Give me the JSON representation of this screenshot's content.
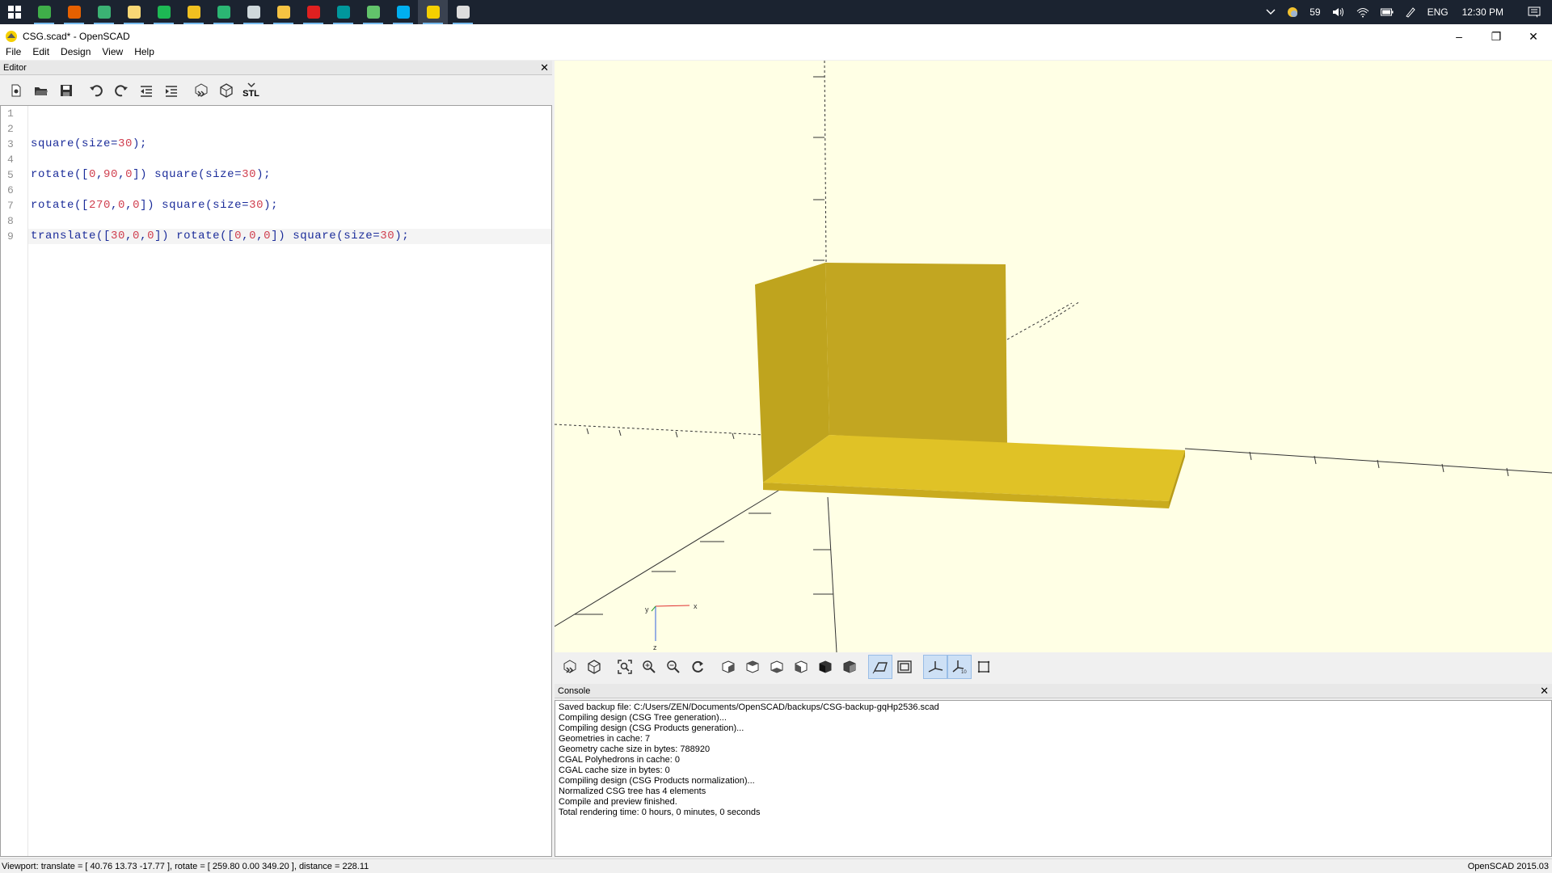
{
  "taskbar": {
    "apps": [
      {
        "name": "notepad-plus",
        "color": "#3fae49"
      },
      {
        "name": "firefox",
        "color": "#e66000"
      },
      {
        "name": "green-app",
        "color": "#3bb274"
      },
      {
        "name": "file-explorer",
        "color": "#f8d775"
      },
      {
        "name": "spotify",
        "color": "#1db954"
      },
      {
        "name": "git",
        "color": "#f0c020"
      },
      {
        "name": "green-arrow-app",
        "color": "#2bb673"
      },
      {
        "name": "terminal-app",
        "color": "#cfd8dc"
      },
      {
        "name": "sticky-notes",
        "color": "#f6c342"
      },
      {
        "name": "acrobat",
        "color": "#e02020"
      },
      {
        "name": "arduino",
        "color": "#00979c"
      },
      {
        "name": "green-circle-app",
        "color": "#62c36b"
      },
      {
        "name": "skype",
        "color": "#00aff0"
      },
      {
        "name": "openscad",
        "color": "#f5d000"
      },
      {
        "name": "chrome",
        "color": "#dddddd"
      }
    ],
    "tray": {
      "temperature": "59",
      "language": "ENG",
      "time": "12:30 PM"
    }
  },
  "window": {
    "title": "CSG.scad* - OpenSCAD",
    "controls": {
      "minimize": "–",
      "maximize": "❐",
      "close": "✕"
    }
  },
  "menu": [
    "File",
    "Edit",
    "Design",
    "View",
    "Help"
  ],
  "editor": {
    "dock_title": "Editor",
    "dock_close": "✕",
    "stl_label": "STL",
    "line_numbers": [
      "1",
      "2",
      "3",
      "4",
      "5",
      "6",
      "7",
      "8",
      "9"
    ],
    "lines": [
      [],
      [],
      [
        {
          "t": "square(size=",
          "k": "f"
        },
        {
          "t": "30",
          "k": "n"
        },
        {
          "t": ");",
          "k": "f"
        }
      ],
      [],
      [
        {
          "t": "rotate([",
          "k": "f"
        },
        {
          "t": "0",
          "k": "n"
        },
        {
          "t": ",",
          "k": "f"
        },
        {
          "t": "90",
          "k": "n"
        },
        {
          "t": ",",
          "k": "f"
        },
        {
          "t": "0",
          "k": "n"
        },
        {
          "t": "]) square(size=",
          "k": "f"
        },
        {
          "t": "30",
          "k": "n"
        },
        {
          "t": ");",
          "k": "f"
        }
      ],
      [],
      [
        {
          "t": "rotate([",
          "k": "f"
        },
        {
          "t": "270",
          "k": "n"
        },
        {
          "t": ",",
          "k": "f"
        },
        {
          "t": "0",
          "k": "n"
        },
        {
          "t": ",",
          "k": "f"
        },
        {
          "t": "0",
          "k": "n"
        },
        {
          "t": "]) square(size=",
          "k": "f"
        },
        {
          "t": "30",
          "k": "n"
        },
        {
          "t": ");",
          "k": "f"
        }
      ],
      [],
      [
        {
          "t": "translate([",
          "k": "f"
        },
        {
          "t": "30",
          "k": "n"
        },
        {
          "t": ",",
          "k": "f"
        },
        {
          "t": "0",
          "k": "n"
        },
        {
          "t": ",",
          "k": "f"
        },
        {
          "t": "0",
          "k": "n"
        },
        {
          "t": "]) rotate([",
          "k": "f"
        },
        {
          "t": "0",
          "k": "n"
        },
        {
          "t": ",",
          "k": "f"
        },
        {
          "t": "0",
          "k": "n"
        },
        {
          "t": ",",
          "k": "f"
        },
        {
          "t": "0",
          "k": "n"
        },
        {
          "t": "]) square(size=",
          "k": "f"
        },
        {
          "t": "30",
          "k": "n"
        },
        {
          "t": ");",
          "k": "f"
        }
      ]
    ],
    "current_line": 9
  },
  "viewport": {
    "background": "#ffffe5",
    "model_color": "#d4b51e",
    "axes_labels": {
      "x": "x",
      "y": "y",
      "z": "z"
    }
  },
  "console": {
    "dock_title": "Console",
    "dock_close": "✕",
    "lines": [
      "Saved backup file: C:/Users/ZEN/Documents/OpenSCAD/backups/CSG-backup-gqHp2536.scad",
      "Compiling design (CSG Tree generation)...",
      "Compiling design (CSG Products generation)...",
      "Geometries in cache: 7",
      "Geometry cache size in bytes: 788920",
      "CGAL Polyhedrons in cache: 0",
      "CGAL cache size in bytes: 0",
      "Compiling design (CSG Products normalization)...",
      "Normalized CSG tree has 4 elements",
      "Compile and preview finished.",
      "Total rendering time: 0 hours, 0 minutes, 0 seconds"
    ]
  },
  "status": {
    "viewport": "Viewport: translate = [ 40.76 13.73 -17.77 ], rotate = [ 259.80 0.00 349.20 ], distance = 228.11",
    "version": "OpenSCAD 2015.03"
  }
}
